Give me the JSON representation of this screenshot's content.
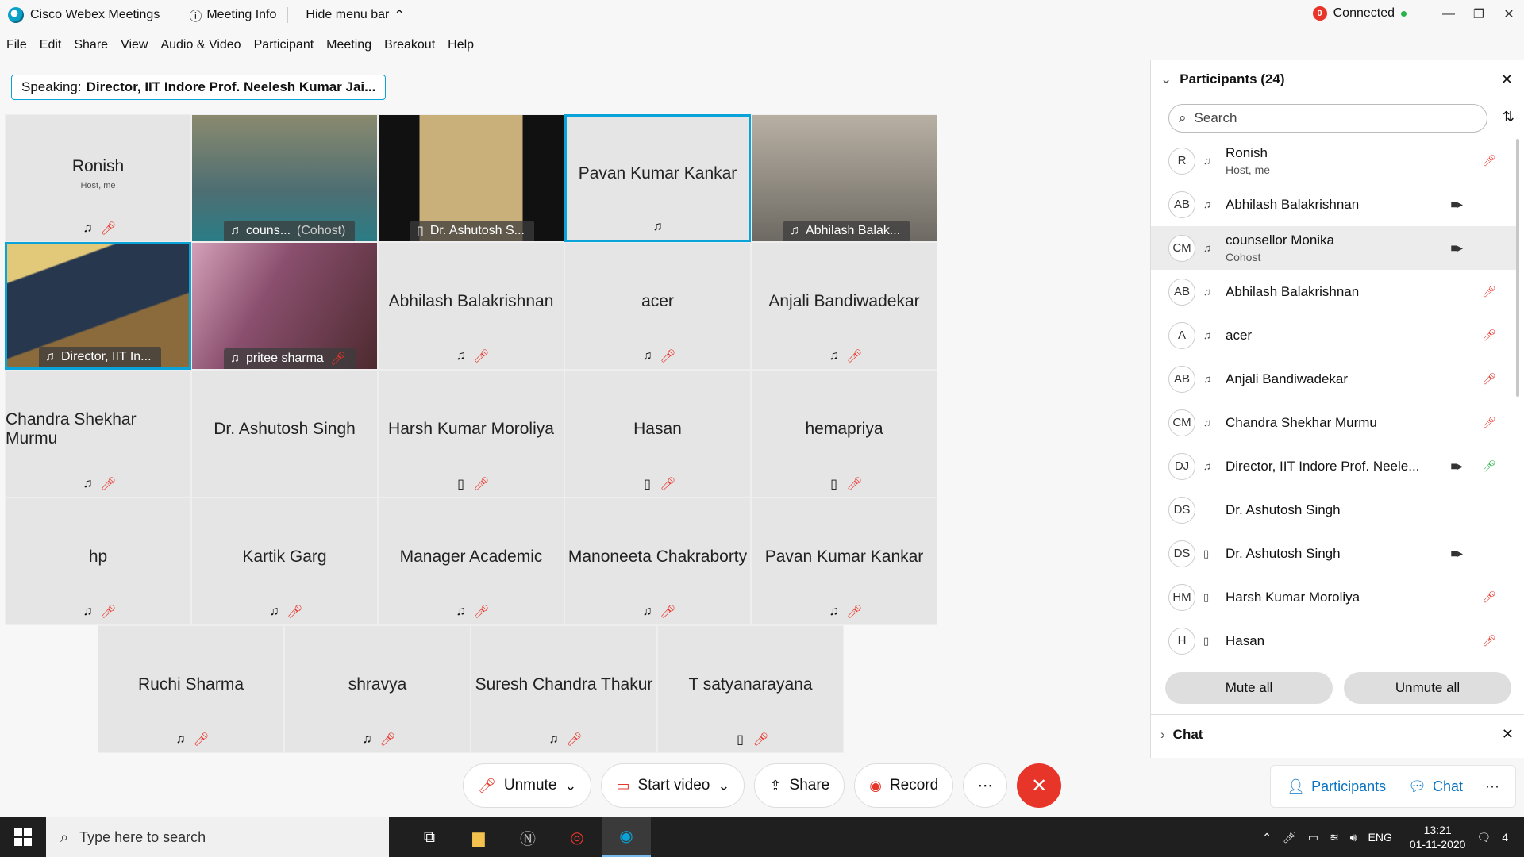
{
  "titlebar": {
    "app_name": "Cisco Webex Meetings",
    "meeting_info": "Meeting Info",
    "hide_menu": "Hide menu bar",
    "connection_badge": "0",
    "connection_status": "Connected"
  },
  "menu": [
    "File",
    "Edit",
    "Share",
    "View",
    "Audio & Video",
    "Participant",
    "Meeting",
    "Breakout",
    "Help"
  ],
  "speaking": {
    "label": "Speaking:",
    "name": "Director, IIT Indore Prof. Neelesh Kumar Jai..."
  },
  "tiles": [
    {
      "name": "Ronish",
      "sub": "Host, me"
    },
    {
      "name": "couns...",
      "sub": "(Cohost)"
    },
    {
      "name": "Dr. Ashutosh S..."
    },
    {
      "name": "Pavan Kumar Kankar"
    },
    {
      "name": "Abhilash Balak..."
    },
    {
      "name": "Director, IIT In..."
    },
    {
      "name": "pritee sharma"
    },
    {
      "name": "Abhilash Balakrishnan"
    },
    {
      "name": "acer"
    },
    {
      "name": "Anjali Bandiwadekar"
    },
    {
      "name": "Chandra Shekhar Murmu"
    },
    {
      "name": "Dr. Ashutosh Singh"
    },
    {
      "name": "Harsh Kumar Moroliya"
    },
    {
      "name": "Hasan"
    },
    {
      "name": "hemapriya"
    },
    {
      "name": "hp"
    },
    {
      "name": "Kartik Garg"
    },
    {
      "name": "Manager Academic"
    },
    {
      "name": "Manoneeta Chakraborty"
    },
    {
      "name": "Pavan Kumar Kankar"
    },
    {
      "name": "Ruchi Sharma"
    },
    {
      "name": "shravya"
    },
    {
      "name": "Suresh Chandra Thakur"
    },
    {
      "name": "T satyanarayana"
    }
  ],
  "panel": {
    "title": "Participants (24)",
    "search_placeholder": "Search",
    "participants": [
      {
        "initials": "R",
        "name": "Ronish",
        "role": "Host, me"
      },
      {
        "initials": "AB",
        "name": "Abhilash Balakrishnan",
        "role": ""
      },
      {
        "initials": "CM",
        "name": "counsellor Monika",
        "role": "Cohost"
      },
      {
        "initials": "AB",
        "name": "Abhilash Balakrishnan",
        "role": ""
      },
      {
        "initials": "A",
        "name": "acer",
        "role": ""
      },
      {
        "initials": "AB",
        "name": "Anjali Bandiwadekar",
        "role": ""
      },
      {
        "initials": "CM",
        "name": "Chandra Shekhar Murmu",
        "role": ""
      },
      {
        "initials": "DJ",
        "name": "Director, IIT Indore Prof. Neele...",
        "role": ""
      },
      {
        "initials": "DS",
        "name": "Dr. Ashutosh Singh",
        "role": ""
      },
      {
        "initials": "DS",
        "name": "Dr. Ashutosh Singh",
        "role": ""
      },
      {
        "initials": "HM",
        "name": "Harsh Kumar Moroliya",
        "role": ""
      },
      {
        "initials": "H",
        "name": "Hasan",
        "role": ""
      }
    ],
    "mute_all": "Mute all",
    "unmute_all": "Unmute all",
    "chat_title": "Chat"
  },
  "controls": {
    "unmute": "Unmute",
    "start_video": "Start video",
    "share": "Share",
    "record": "Record"
  },
  "right_tabs": {
    "participants": "Participants",
    "chat": "Chat"
  },
  "taskbar": {
    "search_placeholder": "Type here to search",
    "lang": "ENG",
    "time": "13:21",
    "date": "01-11-2020",
    "notifications": "4"
  },
  "colors": {
    "accent": "#0aa3d9",
    "danger": "#e8352a",
    "ok": "#2bb34b"
  }
}
